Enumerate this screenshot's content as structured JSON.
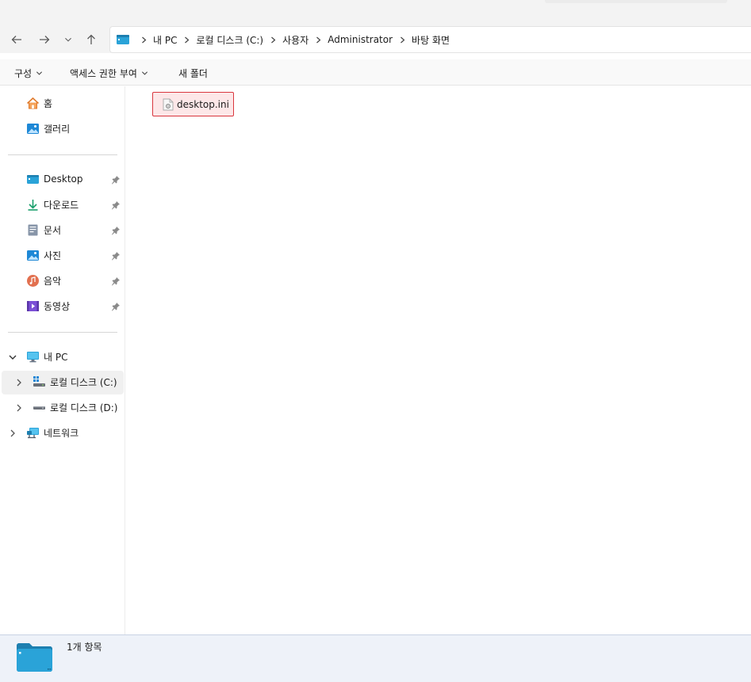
{
  "navigation": {
    "back_icon": "arrow-left-icon",
    "forward_icon": "arrow-right-icon",
    "recent_icon": "chevron-down-icon",
    "up_icon": "arrow-up-icon"
  },
  "address_bar": {
    "breadcrumbs": [
      "내 PC",
      "로컬 디스크 (C:)",
      "사용자",
      "Administrator",
      "바탕 화면"
    ]
  },
  "command_bar": {
    "organize_label": "구성",
    "share_label": "액세스 권한 부여",
    "new_folder_label": "새 폴더"
  },
  "sidebar": {
    "home": "홈",
    "gallery": "갤러리",
    "quick_access": [
      "Desktop",
      "다운로드",
      "문서",
      "사진",
      "음악",
      "동영상"
    ],
    "this_pc": "내 PC",
    "drive_c": "로컬 디스크 (C:)",
    "drive_d": "로컬 디스크 (D:)",
    "network": "네트워크"
  },
  "content": {
    "files": [
      {
        "name": "desktop.ini",
        "selected": true
      }
    ]
  },
  "status_bar": {
    "item_count": "1개 항목"
  },
  "colors": {
    "accent_blue": "#0f6cbd",
    "selection_border": "#d9363e",
    "selection_fill": "#fde7e8",
    "folder_cyan": "#2aa3d8"
  }
}
